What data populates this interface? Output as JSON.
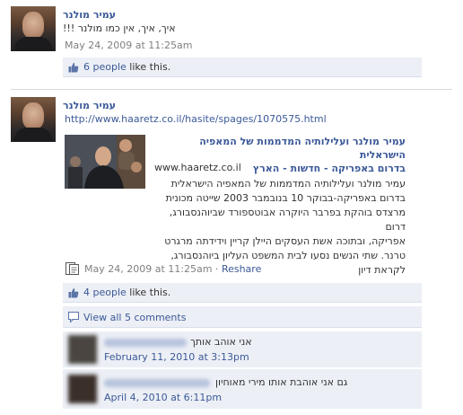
{
  "post1": {
    "author": "עמיר מולנר",
    "message": "איך, איך, אין כמו מולנר !!!",
    "timestamp": "May 24, 2009 at 11:25am",
    "likes": {
      "count": "6 people",
      "suffix": " like this."
    }
  },
  "post2": {
    "author": "עמיר מולנר",
    "url": "http://www.haaretz.co.il/hasite/spages/1070575.html",
    "preview": {
      "title_line1": "עמיר מולנר ועלילותיה המדממות של המאפיה הישראלית",
      "title_line2": "בדרום באפריקה - חדשות - הארץ",
      "domain": "www.haaretz.co.il",
      "desc_lines": [
        "עמיר מולנר ועלילותיה המדממות של המאפיה הישראלית",
        "בדרום באפריקה-בבוקר 10 בנובמבר 2003 שייטה מכונית",
        "מרצדס בוהקת בפרבר היוקרה אבוטספורד שביוהנסבורג, דרום",
        "אפריקה, ובתוכה אשת העסקים היילן קריין וידידתה מרגרט",
        "טרנר. שתי הנשים נסעו לבית המשפט העליון ביוהנסבורג,",
        "לקראת דיון"
      ]
    },
    "timestamp": "May 24, 2009 at 11:25am",
    "separator": " · ",
    "reshare": "Reshare",
    "likes": {
      "count": "4 people",
      "suffix": " like this."
    },
    "view_all": "View all 5 comments",
    "comments": [
      {
        "text": "אני אוהב אותך",
        "time": "February 11, 2010 at 3:13pm"
      },
      {
        "text": "גם אני אוהבת אותו מירי מאוחיון",
        "time": "April 4, 2010 at 6:11pm"
      }
    ]
  },
  "colors": {
    "link": "#3b5998",
    "likebar": "#eceff5",
    "meta": "#808080"
  }
}
